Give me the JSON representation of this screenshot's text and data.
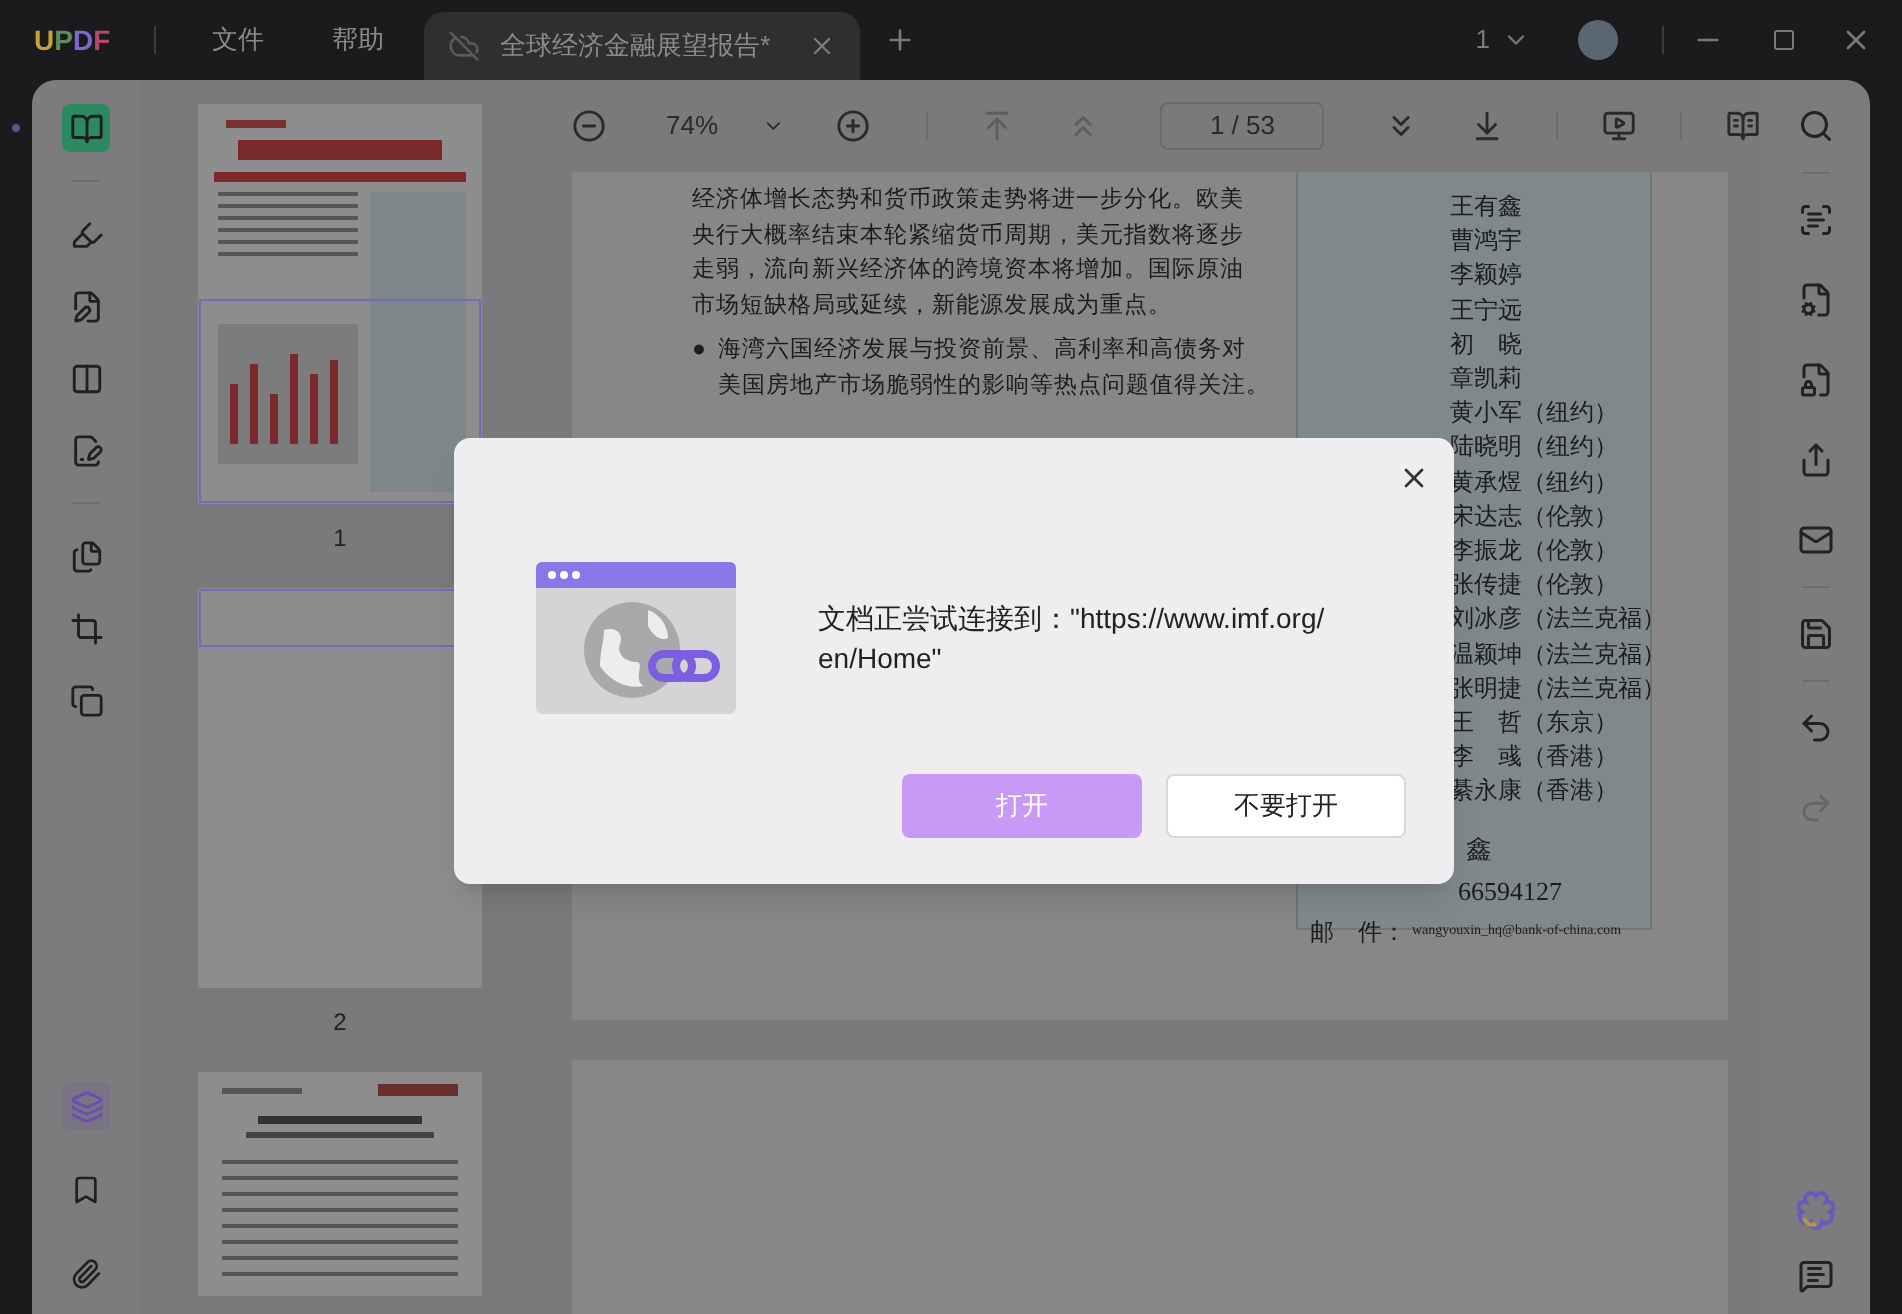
{
  "app": {
    "logo": "UPDF",
    "menu": [
      "文件",
      "帮助"
    ]
  },
  "tabs": [
    {
      "title": "全球经济金融展望报告*",
      "selected": true
    }
  ],
  "account": {
    "page_selector": "1"
  },
  "toolbar": {
    "zoom": "74%",
    "page_field": "1 / 53"
  },
  "left_tools": [
    {
      "kind": "reader",
      "selected": true
    },
    {
      "kind": "divider"
    },
    {
      "kind": "comment",
      "selected": false
    },
    {
      "kind": "edit",
      "selected": false
    },
    {
      "kind": "form",
      "selected": false
    },
    {
      "kind": "sign",
      "selected": false
    },
    {
      "kind": "divider"
    },
    {
      "kind": "organize",
      "selected": false
    },
    {
      "kind": "crop",
      "selected": false
    },
    {
      "kind": "overlay",
      "selected": false
    }
  ],
  "thumbnails": [
    {
      "label": "1",
      "kind": "cover"
    },
    {
      "label": "2",
      "kind": "blank"
    },
    {
      "kind": "text"
    }
  ],
  "document": {
    "paragraph_lines": [
      "经济体增长态势和货币政策走势将进一步分化。欧美",
      "央行大概率结束本轮紧缩货币周期，美元指数将逐步",
      "走弱，流向新兴经济体的跨境资本将增加。国际原油",
      "市场短缺格局或延续，新能源发展成为重点。"
    ],
    "bullet": "●",
    "bullet_lines": [
      "海湾六国经济发展与投资前景、高利率和高债务对",
      "美国房地产市场脆弱性的影响等热点问题值得关注。"
    ],
    "contacts": [
      "王有鑫",
      "曹鸿宇",
      "李颖婷",
      "王宁远",
      "初　晓",
      "章凯莉",
      "黄小军（纽约）",
      "陆晓明（纽约）",
      "黄承煜（纽约）",
      "宋达志（伦敦）",
      "李振龙（伦敦）",
      "张传捷（伦敦）",
      "刘冰彦（法兰克福）",
      "温颖坤（法兰克福）",
      "张明捷（法兰克福）",
      "王　哲（东京）",
      "李　彧（香港）",
      "綦永康（香港）"
    ],
    "contact_name_fragment": "鑫",
    "phone_fragment": "66594127",
    "email_label": "邮　件：",
    "email": "wangyouxin_hq@bank-of-china.com"
  },
  "dialog": {
    "message_lines": [
      "文档正尝试连接到：\"https://www.imf.org/",
      "en/Home\""
    ],
    "buttons": [
      {
        "label": "打开",
        "kind": "primary"
      },
      {
        "label": "不要打开",
        "kind": "secondary"
      }
    ]
  }
}
